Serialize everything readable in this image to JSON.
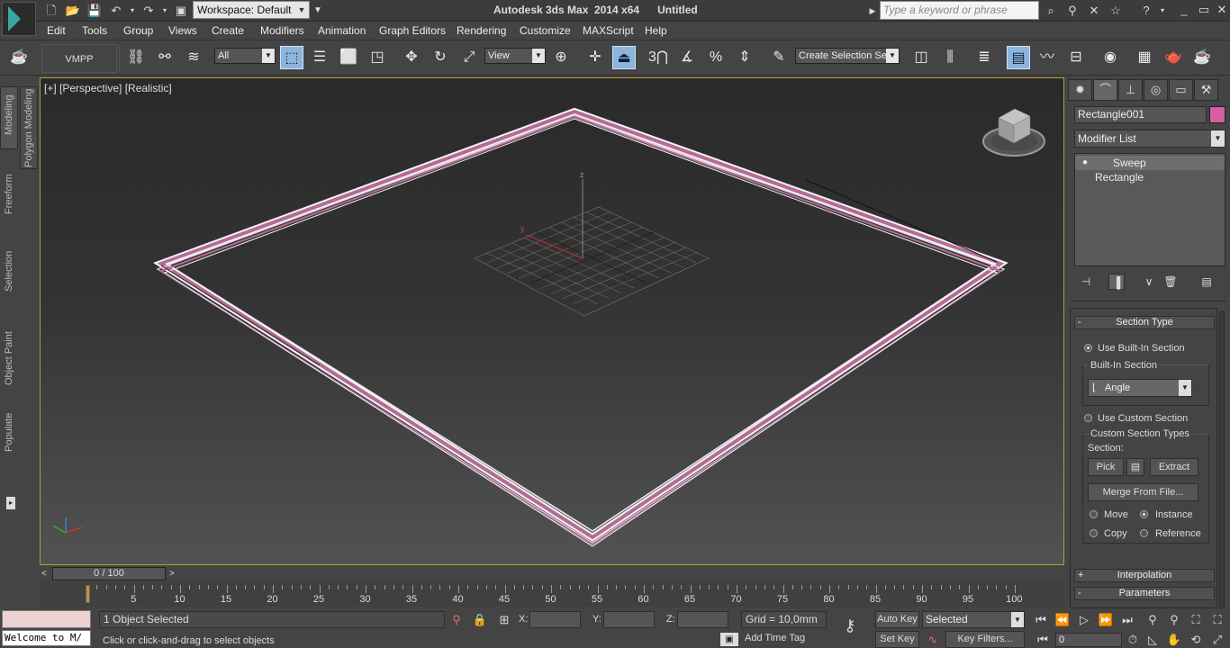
{
  "titlebar": {
    "workspace": "Workspace: Default",
    "title": "Autodesk 3ds Max  2014 x64      Untitled",
    "search_placeholder": "Type a keyword or phrase"
  },
  "menu": [
    "Edit",
    "Tools",
    "Group",
    "Views",
    "Create",
    "Modifiers",
    "Animation",
    "Graph Editors",
    "Rendering",
    "Customize",
    "MAXScript",
    "Help"
  ],
  "toolbar": {
    "vmpp": "VMPP",
    "filter": "All",
    "ref_coord": "View",
    "snap_3": "3",
    "named_selection": "Create Selection Se"
  },
  "ribbon_tabs": [
    "Modeling",
    "Polygon Modeling",
    "Freeform",
    "Selection",
    "Object Paint",
    "Populate"
  ],
  "viewport": {
    "label": "[+] [Perspective] [Realistic]",
    "axis_z": "z",
    "axis_y": "y"
  },
  "command_panel": {
    "object_name": "Rectangle001",
    "object_color": "#d4609f",
    "modifier_list": "Modifier List",
    "stack": [
      "Sweep",
      "Rectangle"
    ],
    "rollouts": {
      "section_type": "Section Type",
      "use_builtin": "Use Built-In Section",
      "builtin_group": "Built-In Section",
      "builtin_value": "Angle",
      "use_custom": "Use Custom Section",
      "custom_group": "Custom Section Types",
      "section_label": "Section:",
      "pick": "Pick",
      "extract": "Extract",
      "merge": "Merge From File...",
      "move": "Move",
      "instance": "Instance",
      "copy": "Copy",
      "reference": "Reference",
      "interpolation": "Interpolation",
      "parameters": "Parameters"
    }
  },
  "timeline": {
    "slider": "0 / 100",
    "ticks": [
      "5",
      "10",
      "15",
      "20",
      "25",
      "30",
      "35",
      "40",
      "45",
      "50",
      "55",
      "60",
      "65",
      "70",
      "75",
      "80",
      "85",
      "90",
      "95",
      "100"
    ]
  },
  "status": {
    "maxscript": "Welcome to M/",
    "selection": "1 Object Selected",
    "prompt": "Click or click-and-drag to select objects",
    "x_label": "X:",
    "y_label": "Y:",
    "z_label": "Z:",
    "grid": "Grid = 10,0mm",
    "add_time_tag": "Add Time Tag",
    "auto_key": "Auto Key",
    "set_key": "Set Key",
    "selected": "Selected",
    "key_filters": "Key Filters...",
    "frame": "0"
  }
}
